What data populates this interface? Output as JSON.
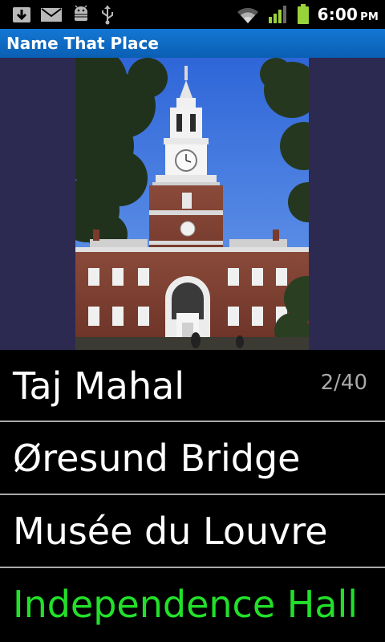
{
  "status_bar": {
    "time": "6:00",
    "ampm": "PM",
    "left_icons": [
      "download-icon",
      "mail-icon",
      "android-debug-icon",
      "usb-icon"
    ],
    "right_icons": [
      "wifi-icon",
      "signal-icon",
      "battery-icon"
    ]
  },
  "app": {
    "title": "Name That Place",
    "accent_color": "#0a6cc8"
  },
  "photo": {
    "subject": "Independence Hall"
  },
  "quiz": {
    "progress": "2/40",
    "choices": [
      {
        "label": "Taj Mahal"
      },
      {
        "label": "Øresund Bridge"
      },
      {
        "label": "Musée du Louvre"
      },
      {
        "label": "Independence Hall",
        "correct": true
      }
    ],
    "correct_color": "#22e02a"
  }
}
